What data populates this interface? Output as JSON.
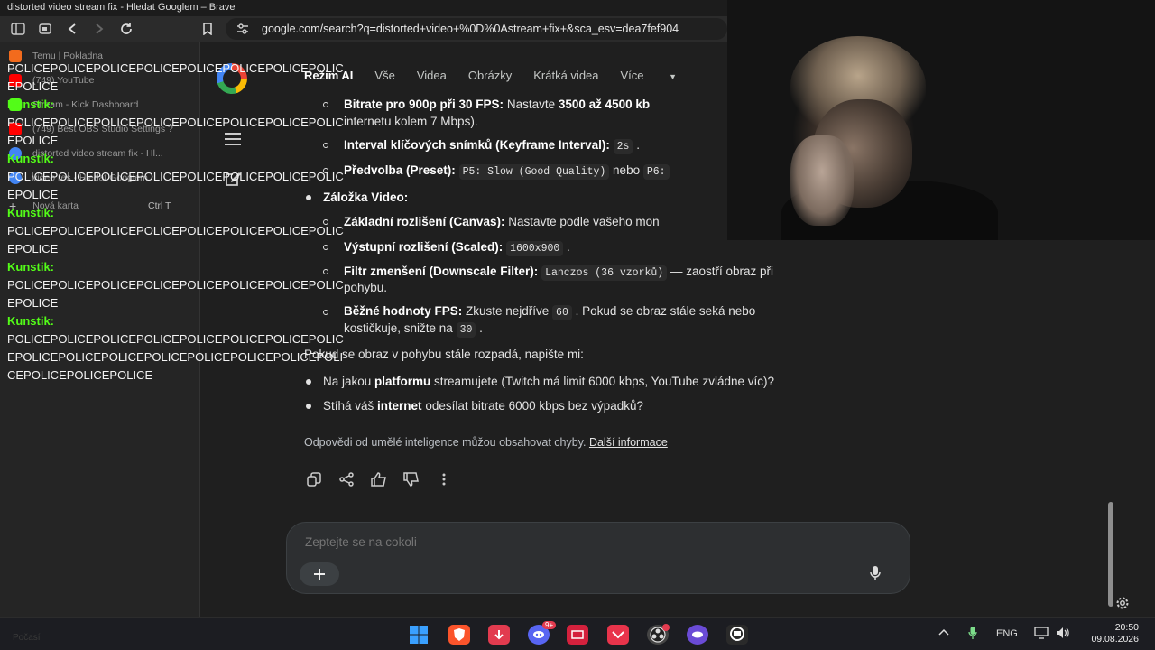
{
  "window": {
    "title": "distorted video stream fix - Hledat Googlem – Brave"
  },
  "browser": {
    "url": "google.com/search?q=distorted+video+%0D%0Astream+fix+&sca_esv=dea7fef904",
    "tabs": [
      {
        "label": "Temu | Pokladna",
        "color": "#f26b1d"
      },
      {
        "label": "(749) YouTube",
        "color": "#ff0000"
      },
      {
        "label": "Stream - Kick Dashboard",
        "color": "#53fc18"
      },
      {
        "label": "(749) Best OBS Studio Settings ?",
        "color": "#ff0000"
      },
      {
        "label": "distorted video stream fix - Hl...",
        "color": "#4285f4"
      },
      {
        "label": "video res - Hledat Googlem",
        "color": "#4285f4"
      },
      {
        "label": "Nová karta",
        "color": "#555555"
      }
    ],
    "new_tab_shortcut": "Ctrl   T"
  },
  "google": {
    "nav_tabs": [
      "Režim AI",
      "Vše",
      "Videa",
      "Obrázky",
      "Krátká videa",
      "Více"
    ],
    "answer": {
      "l1_bold": "Bitrate pro 900p při 30 FPS:",
      "l1_text": " Nastavte ",
      "l1_b2": "3500 až 4500 kb",
      "l2_text": "internetu kolem 7 Mbps).",
      "l3_bold": "Interval klíčových snímků (Keyframe Interval):",
      "l3_code": "2s",
      "l4_bold": "Předvolba (Preset):",
      "l4_code": "P5: Slow (Good Quality)",
      "l4_text": " nebo ",
      "l4_code2": "P6:",
      "l5_text": "Záložka Video:",
      "l6_bold": "Základní rozlišení (Canvas):",
      "l6_text": " Nastavte podle vašeho mon",
      "l7_bold": "Výstupní rozlišení (Scaled):",
      "l7_code": "1600x900",
      "l8_bold": "Filtr zmenšení (Downscale Filter):",
      "l8_code": "Lanczos (36 vzorků)",
      "l8_text": " — zaostří obraz při",
      "l9_text": "pohybu.",
      "l10_bold": "Běžné hodnoty FPS:",
      "l10_text": " Zkuste nejdříve ",
      "l10_code": "60",
      "l10_text2": " . Pokud se obraz stále seká nebo",
      "l11_text": "kostičkuje, snižte na ",
      "l11_code": "30",
      "l12_text": "Pokud se obraz v pohybu stále rozpadá, napište mi:",
      "l13_text1": "Na jakou ",
      "l13_bold": "platformu",
      "l13_text2": " streamujete (Twitch má limit 6000 kbps, YouTube zvládne víc)?",
      "l14_text1": "Stíhá váš ",
      "l14_bold": "internet",
      "l14_text2": " odesílat bitrate 6000 kbps bez výpadků?"
    },
    "disclaimer": "Odpovědi od umělé inteligence můžou obsahovat chyby.",
    "more_info": "Další informace",
    "ask_placeholder": "Zeptejte se na cokoli"
  },
  "chat": {
    "messages": [
      {
        "user": "",
        "text": "POLICEPOLICEPOLICEPOLICEPOLICEPOLICEPOLICEPOLICEPOLICE"
      },
      {
        "user": "Kunstik:",
        "text": "POLICEPOLICEPOLICEPOLICEPOLICEPOLICEPOLICEPOLICEPOLICE"
      },
      {
        "user": "Kunstik:",
        "text": "POLICEPOLICEPOLICEPOLICEPOLICEPOLICEPOLICEPOLICEPOLICE"
      },
      {
        "user": "Kunstik:",
        "text": "POLICEPOLICEPOLICEPOLICEPOLICEPOLICEPOLICEPOLICEPOLICE"
      },
      {
        "user": "Kunstik:",
        "text": "POLICEPOLICEPOLICEPOLICEPOLICEPOLICEPOLICEPOLICEPOLICE"
      },
      {
        "user": "Kunstik:",
        "text": "POLICEPOLICEPOLICEPOLICEPOLICEPOLICEPOLICEPOLICEPOLICEPOLICEPOLICEPOLICEPOLICEPOLICEPOLICEPOLICEPOLICEPOLICEPOLICE"
      }
    ]
  },
  "taskbar": {
    "apps": [
      {
        "icon": "windows-start-icon",
        "color": "#3aa0ff"
      },
      {
        "icon": "brave-icon",
        "color": "#fb542b"
      },
      {
        "icon": "app-red-icon",
        "color": "#e23b4f"
      },
      {
        "icon": "discord-icon",
        "color": "#5865f2"
      },
      {
        "icon": "app-red2-icon",
        "color": "#d4213d"
      },
      {
        "icon": "app-red3-icon",
        "color": "#e8344b"
      },
      {
        "icon": "obs-icon",
        "color": "#444444"
      },
      {
        "icon": "app-purple-icon",
        "color": "#6a4bd6"
      },
      {
        "icon": "app-chat-icon",
        "color": "#2a2a2a"
      }
    ],
    "discord_badge": "9+",
    "language": "ENG",
    "time": "20:50",
    "date": "09.08.2026",
    "faint_text": "Počasí"
  },
  "colors": {
    "kick_green": "#53fc18",
    "background": "#1f1f1f"
  }
}
